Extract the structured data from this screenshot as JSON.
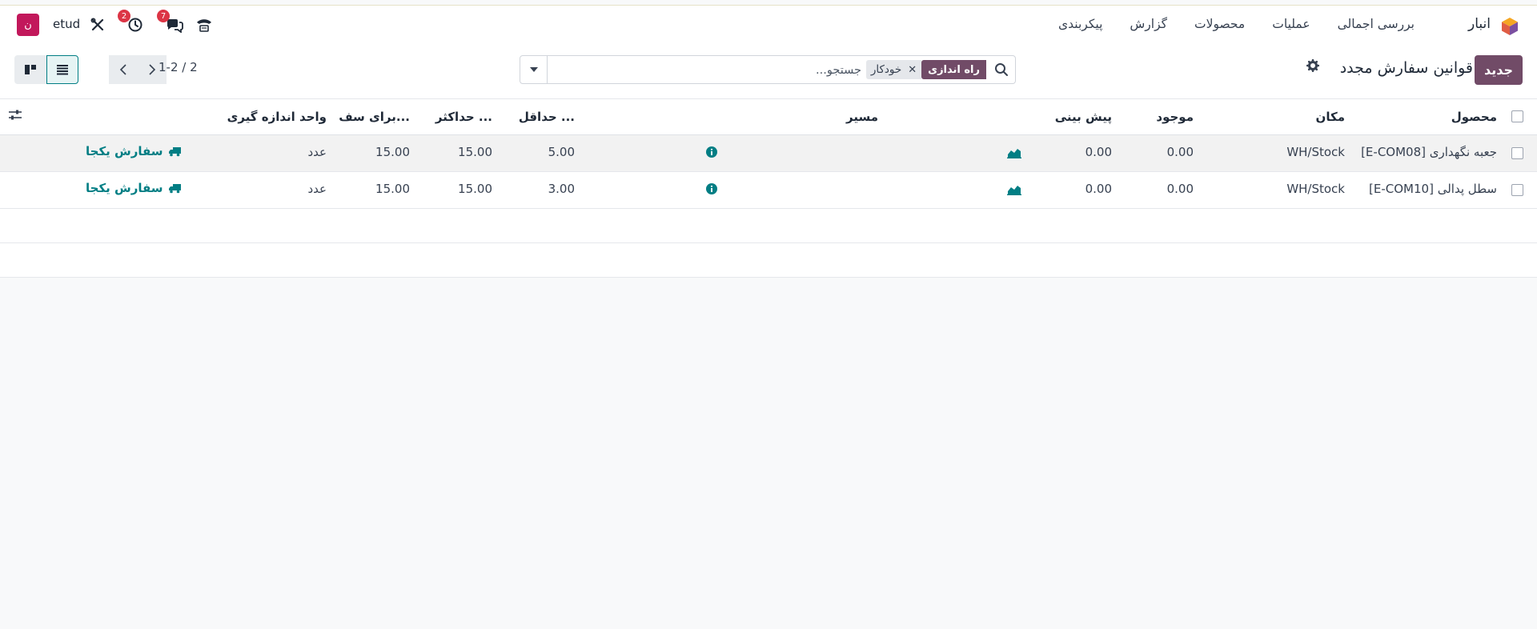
{
  "colors": {
    "brand": "#714b67",
    "link": "#017e84",
    "badge": "#dc3545",
    "avatar": "#c2185b"
  },
  "navbar": {
    "app_title": "انبار",
    "app_icon": "inventory-cube-icon",
    "menu": [
      "بررسی اجمالی",
      "عملیات",
      "محصولات",
      "گزارش",
      "پیکربندی"
    ],
    "user": {
      "name": "etud",
      "avatar_letter": "ن"
    },
    "activity_badge": "2",
    "messages_badge": "7"
  },
  "control_panel": {
    "new_button": "جدید",
    "title": "قوانین سفارش مجدد",
    "search": {
      "facet_label": "راه اندازی",
      "facet_value": "خودکار",
      "placeholder": "جستجو..."
    },
    "pager": "1-2 / 2"
  },
  "table": {
    "headers": {
      "product": "محصول",
      "location": "مکان",
      "on_hand": "موجود",
      "forecast": "پیش بینی",
      "route": "مسیر",
      "min": "حداقل ...",
      "max": "حداکثر ...",
      "multiple": "برای سف...",
      "uom": "واحد اندازه گیری"
    },
    "rows": [
      {
        "product": "[E-COM08] جعبه نگهداری",
        "location": "WH/Stock",
        "on_hand": "0.00",
        "forecast": "0.00",
        "min": "5.00",
        "max": "15.00",
        "multiple": "15.00",
        "uom": "عدد",
        "action": "سفارش یکجا"
      },
      {
        "product": "[E-COM10] سطل پدالی",
        "location": "WH/Stock",
        "on_hand": "0.00",
        "forecast": "0.00",
        "min": "3.00",
        "max": "15.00",
        "multiple": "15.00",
        "uom": "عدد",
        "action": "سفارش یکجا"
      }
    ]
  }
}
